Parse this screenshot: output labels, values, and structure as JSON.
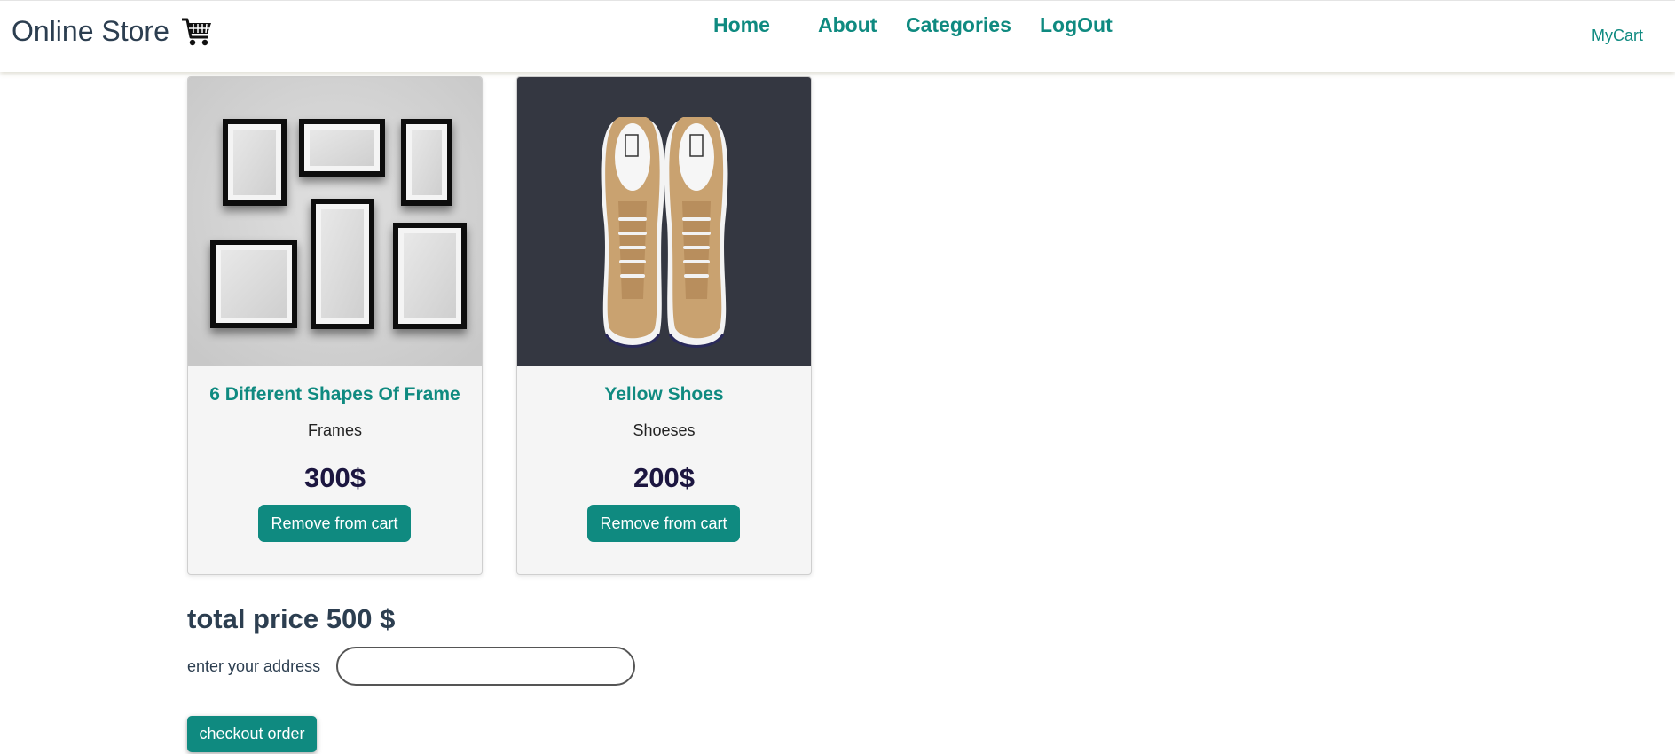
{
  "navbar": {
    "brand": "Online Store",
    "brand_icon": "shopping-cart-icon",
    "links": [
      "Home",
      "About",
      "Categories",
      "LogOut"
    ],
    "mycart": "MyCart"
  },
  "cart": {
    "items": [
      {
        "title": "6 Different Shapes Of Frame",
        "category": "Frames",
        "price": "300$",
        "button": "Remove from cart",
        "image": "picture-frames-image"
      },
      {
        "title": "Yellow Shoes",
        "category": "Shoeses",
        "price": "200$",
        "button": "Remove from cart",
        "image": "yellow-shoes-image"
      }
    ]
  },
  "checkout": {
    "total": "total price 500 $",
    "address_label": "enter your address",
    "address_value": "",
    "button": "checkout order"
  },
  "colors": {
    "accent": "#0f8a80",
    "text": "#2c3e50",
    "price": "#1c1640",
    "card_bg": "#f5f5f5"
  }
}
